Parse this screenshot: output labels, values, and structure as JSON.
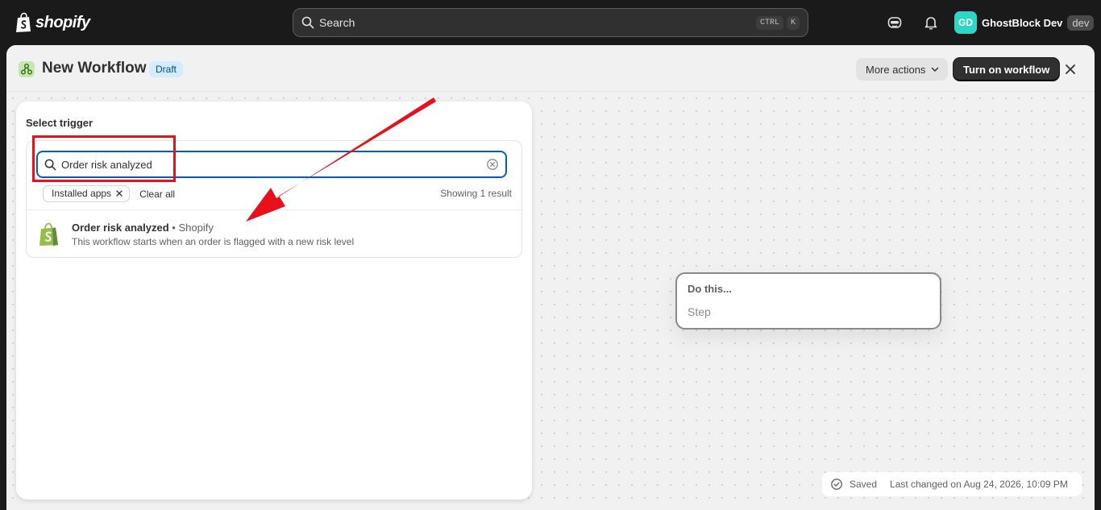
{
  "topbar": {
    "logo_text": "shopify",
    "search_label": "Search",
    "shortcut_keys": [
      "CTRL",
      "K"
    ],
    "user_initials": "GD",
    "user_name": "GhostBlock Dev",
    "env_badge": "dev"
  },
  "header": {
    "title": "New Workflow",
    "status_badge": "Draft",
    "more_actions_label": "More actions",
    "turn_on_label": "Turn on workflow"
  },
  "trigger_panel": {
    "title": "Select trigger",
    "search_value": "Order risk analyzed",
    "filter_chip": "Installed apps",
    "clear_all": "Clear all",
    "result_count": "Showing 1 result",
    "results": [
      {
        "name": "Order risk analyzed",
        "source": "• Shopify",
        "description": "This workflow starts when an order is flagged with a new risk level"
      }
    ]
  },
  "step_card": {
    "title": "Do this...",
    "placeholder": "Step"
  },
  "status": {
    "saved": "Saved",
    "last_changed": "Last changed on Aug 24, 2026, 10:09 PM"
  },
  "colors": {
    "accent": "#005bd3",
    "primary_button": "#303030",
    "annotation": "#e8101a",
    "avatar": "#2ed6c7",
    "shopify_green": "#95bf47"
  }
}
